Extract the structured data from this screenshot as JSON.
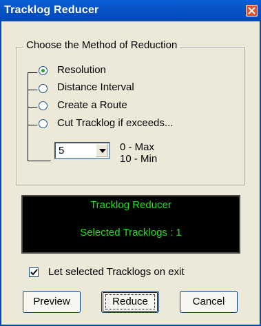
{
  "window": {
    "title": "Tracklog Reducer"
  },
  "group": {
    "legend": "Choose the Method of Reduction",
    "options": [
      {
        "label": "Resolution",
        "selected": true
      },
      {
        "label": "Distance Interval",
        "selected": false
      },
      {
        "label": "Create a Route",
        "selected": false
      },
      {
        "label": "Cut Tracklog if exceeds...",
        "selected": false
      }
    ],
    "level": {
      "value": "5",
      "max_label": "0  - Max",
      "min_label": "10 - Min"
    }
  },
  "display": {
    "title": "Tracklog Reducer",
    "status": "Selected Tracklogs : 1",
    "text_color": "#1fe01f"
  },
  "checkbox": {
    "label": "Let selected Tracklogs on exit",
    "checked": true
  },
  "buttons": {
    "preview": "Preview",
    "reduce": "Reduce",
    "cancel": "Cancel"
  },
  "icons": {
    "close": "close-icon",
    "dropdown": "chevron-down-icon",
    "check": "checkmark-icon"
  }
}
